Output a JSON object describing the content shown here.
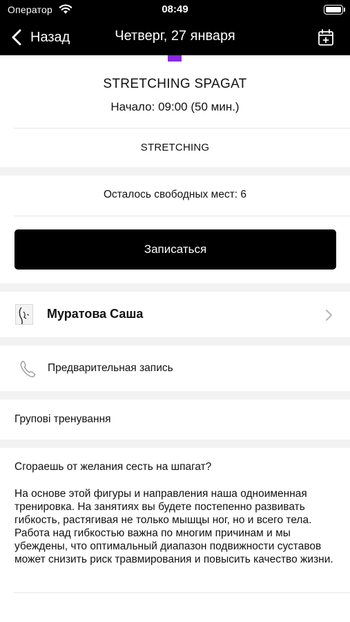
{
  "status_bar": {
    "carrier": "Оператор",
    "time": "08:49"
  },
  "nav": {
    "back_label": "Назад",
    "title": "Четверг, 27 января"
  },
  "accent_color": "#8a2be2",
  "class_info": {
    "title": "STRETCHING SPAGAT",
    "start": "Начало: 09:00 (50 мин.)",
    "category": "STRETCHING"
  },
  "booking": {
    "free_seats": "Осталось свободных мест: 6",
    "button_label": "Записаться"
  },
  "trainer": {
    "name": "Муратова Саша"
  },
  "preregistration": {
    "label": "Предварительная запись"
  },
  "group": {
    "label": "Групові тренування"
  },
  "description": {
    "heading": "Сгораешь от желания сесть на шпагат?",
    "body": "На основе этой фигуры и направления наша одноименная тренировка. На занятиях вы будете постепенно развивать гибкость, растягивая не только мышцы ног, но и всего тела. Работа над гибкостью важна по многим причинам и мы убеждены, что оптимальный диапазон подвижности суставов может снизить риск травмирования и повысить качество жизни."
  }
}
